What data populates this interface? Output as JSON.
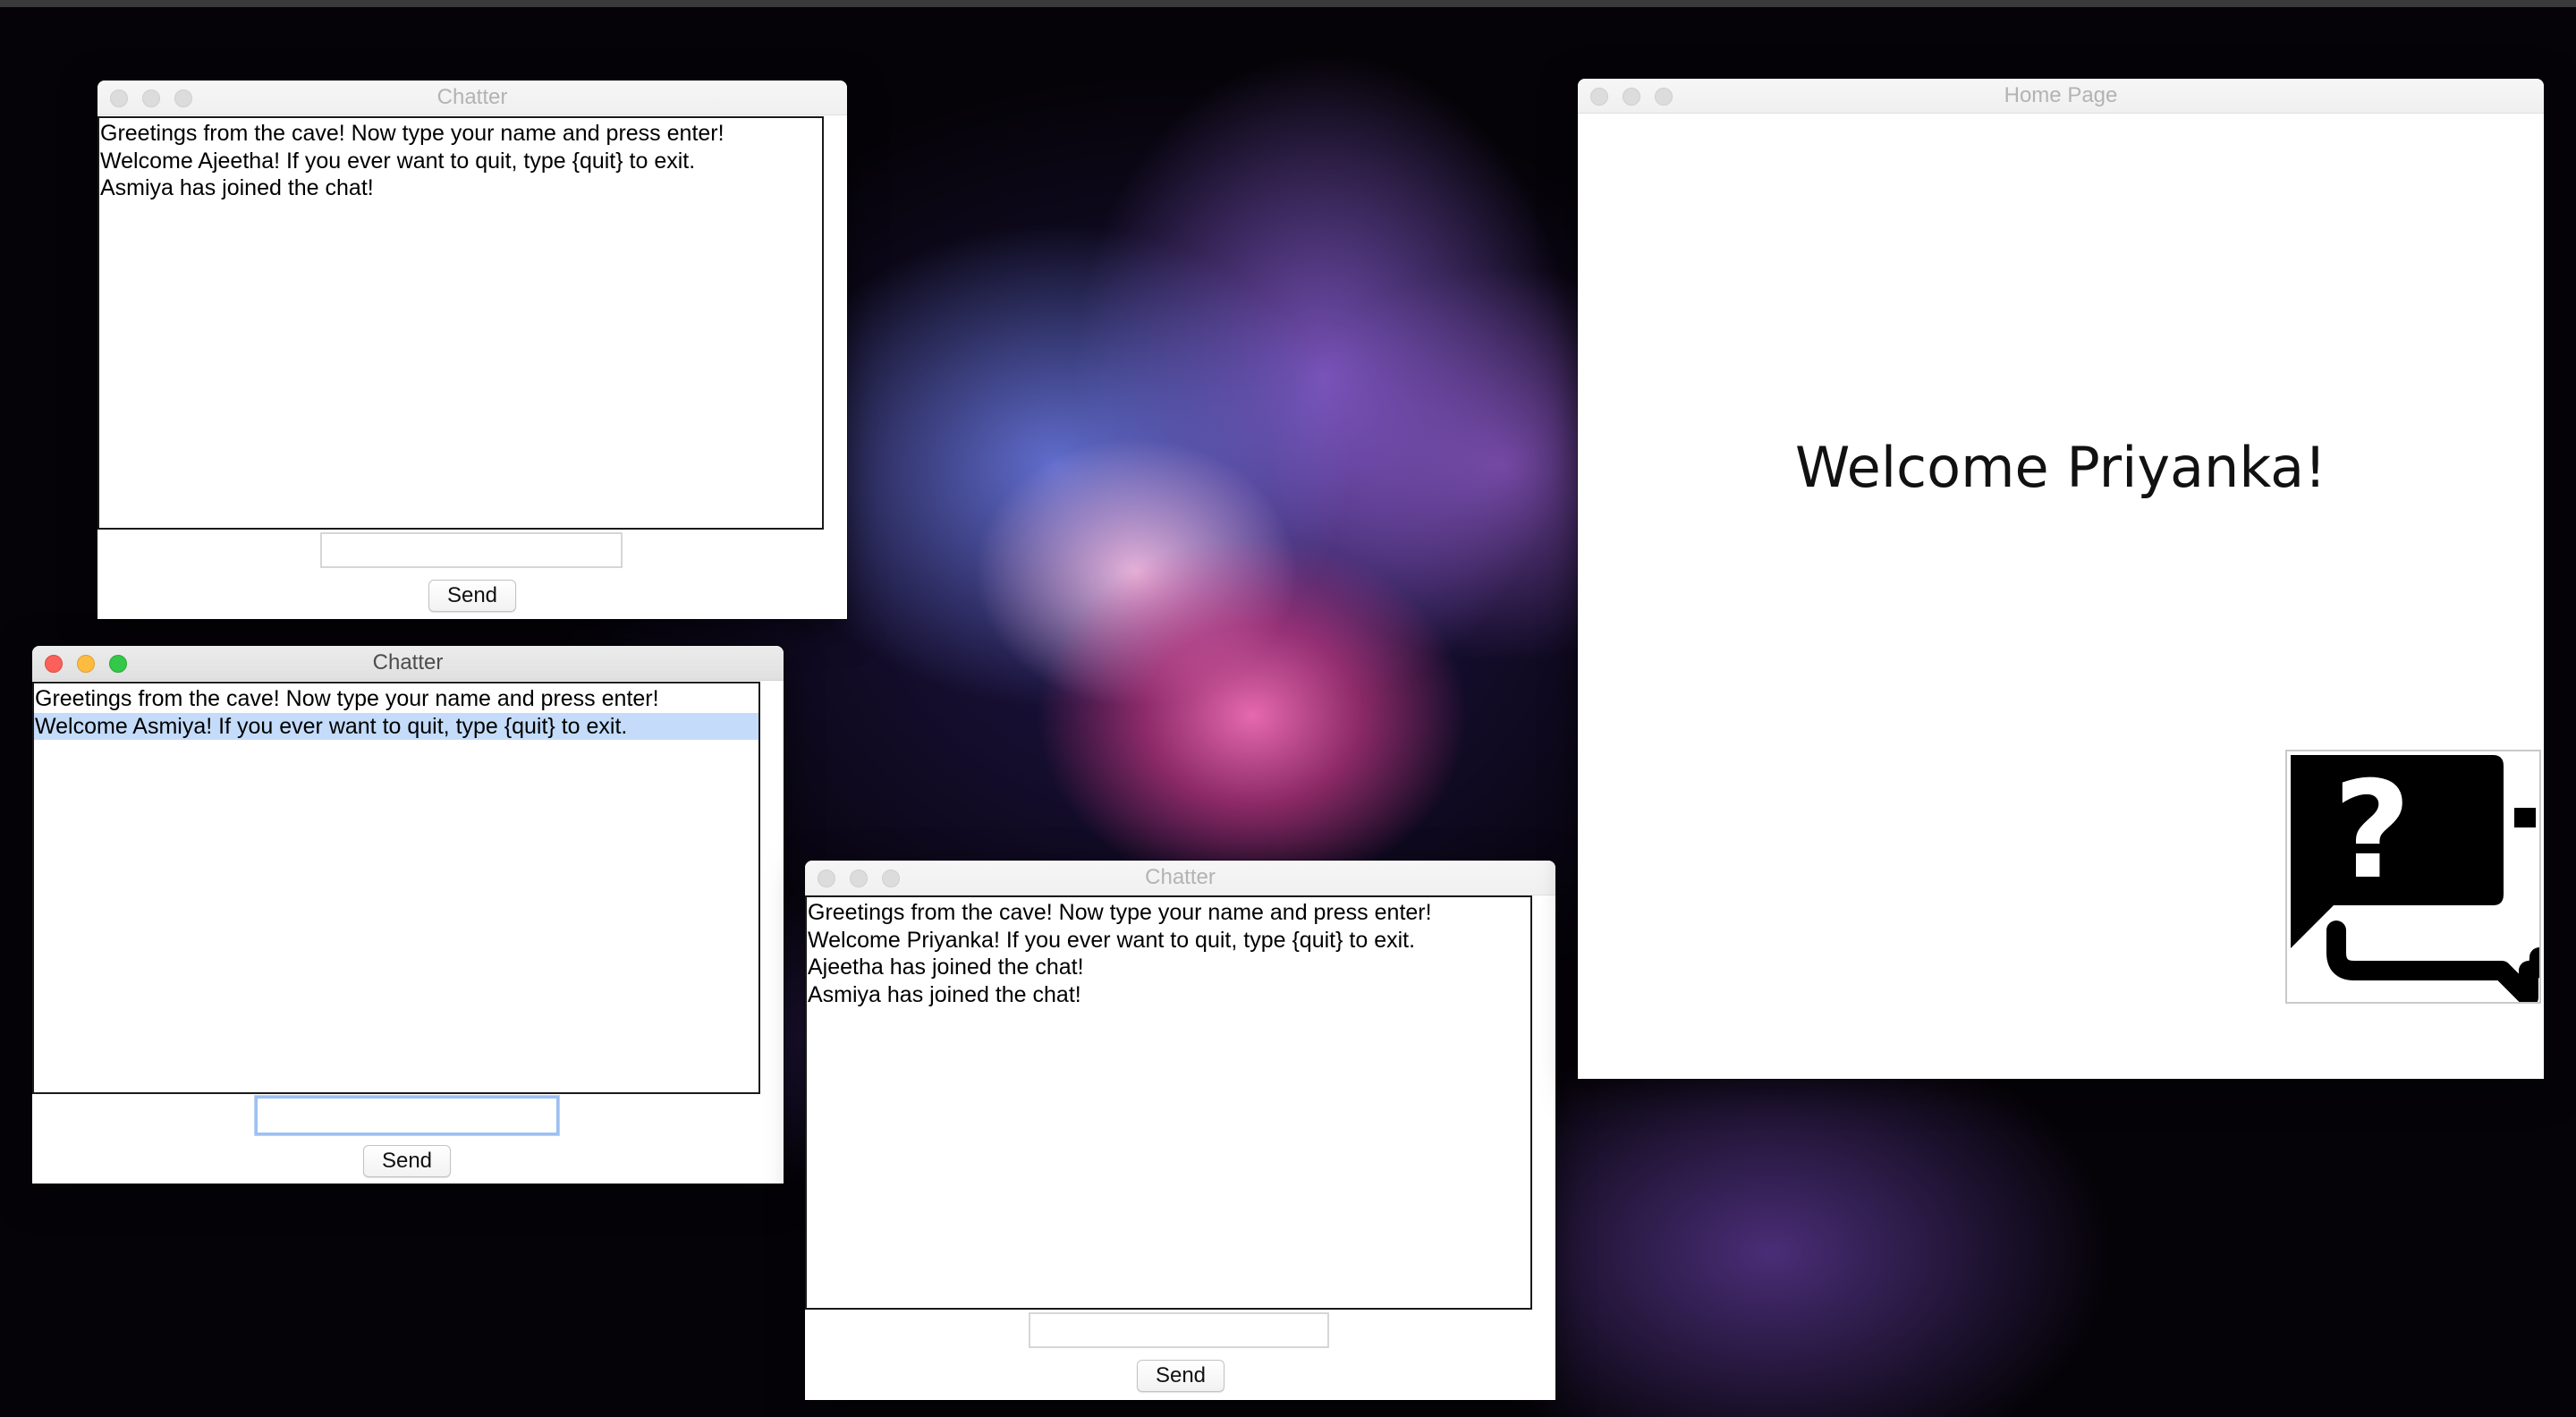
{
  "desktop": {
    "wallpaper": "colorful powder explosion on black",
    "accent_colors": {
      "pink": "#e03c8c",
      "blue": "#788cff",
      "purple": "#a06ef0",
      "background": "#050308"
    }
  },
  "windows": {
    "chatter_ajeetha": {
      "title": "Chatter",
      "state": "inactive",
      "messages": [
        "Greetings from the cave! Now type your name and press enter!",
        "Welcome Ajeetha! If you ever want to quit, type {quit} to exit.",
        "Asmiya has joined the chat!"
      ],
      "input": {
        "value": "",
        "placeholder": ""
      },
      "send_label": "Send"
    },
    "chatter_asmiya": {
      "title": "Chatter",
      "state": "active",
      "messages": [
        "Greetings from the cave! Now type your name and press enter!",
        "Welcome Asmiya! If you ever want to quit, type {quit} to exit."
      ],
      "selected_message": "Welcome Asmiya! If you ever want to quit, type {quit} to exit.",
      "input": {
        "value": "",
        "placeholder": "",
        "focused": true
      },
      "send_label": "Send"
    },
    "chatter_priyanka": {
      "title": "Chatter",
      "state": "inactive",
      "messages": [
        "Greetings from the cave! Now type your name and press enter!",
        "Welcome Priyanka! If you ever want to quit, type {quit} to exit.",
        "Ajeetha has joined the chat!",
        "Asmiya has joined the chat!"
      ],
      "input": {
        "value": "",
        "placeholder": ""
      },
      "send_label": "Send"
    },
    "home_page": {
      "title": "Home Page",
      "state": "inactive",
      "welcome_text": "Welcome Priyanka!",
      "help_icon": "chat-help-icon"
    }
  }
}
